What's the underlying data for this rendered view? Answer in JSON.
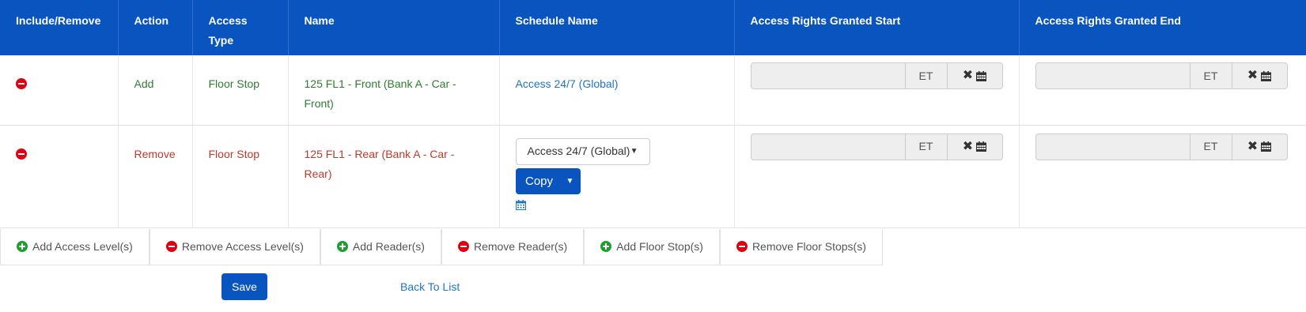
{
  "table": {
    "headers": [
      "Include/Remove",
      "Action",
      "Access\nType",
      "Name",
      "Schedule Name",
      "Access Rights Granted Start",
      "Access Rights Granted End"
    ],
    "rows": [
      {
        "action": "Add",
        "access_type": "Floor Stop",
        "name": "125 FL1 - Front (Bank A - Car - Front)",
        "schedule": "Access 24/7 (Global)",
        "start": {
          "value": "",
          "tz": "ET"
        },
        "end": {
          "value": "",
          "tz": "ET"
        }
      },
      {
        "action": "Remove",
        "access_type": "Floor Stop",
        "name": "125 FL1 - Rear (Bank A - Car - Rear)",
        "schedule_select": "Access 24/7 (Global)",
        "copy_label": "Copy",
        "start": {
          "value": "",
          "tz": "ET"
        },
        "end": {
          "value": "",
          "tz": "ET"
        }
      }
    ]
  },
  "actions": [
    {
      "label": "Add Access Level(s)",
      "icon": "plus-circle-icon"
    },
    {
      "label": "Remove Access Level(s)",
      "icon": "minus-circle-icon"
    },
    {
      "label": "Add Reader(s)",
      "icon": "plus-circle-icon"
    },
    {
      "label": "Remove Reader(s)",
      "icon": "minus-circle-icon"
    },
    {
      "label": "Add Floor Stop(s)",
      "icon": "plus-circle-icon"
    },
    {
      "label": "Remove Floor Stops(s)",
      "icon": "minus-circle-icon"
    }
  ],
  "footer": {
    "save_label": "Save",
    "back_label": "Back To List"
  },
  "colors": {
    "header_bg": "#0a54bf",
    "add_green": "#2e7d32",
    "remove_red": "#c0392b",
    "link_blue": "#1f74c4"
  }
}
